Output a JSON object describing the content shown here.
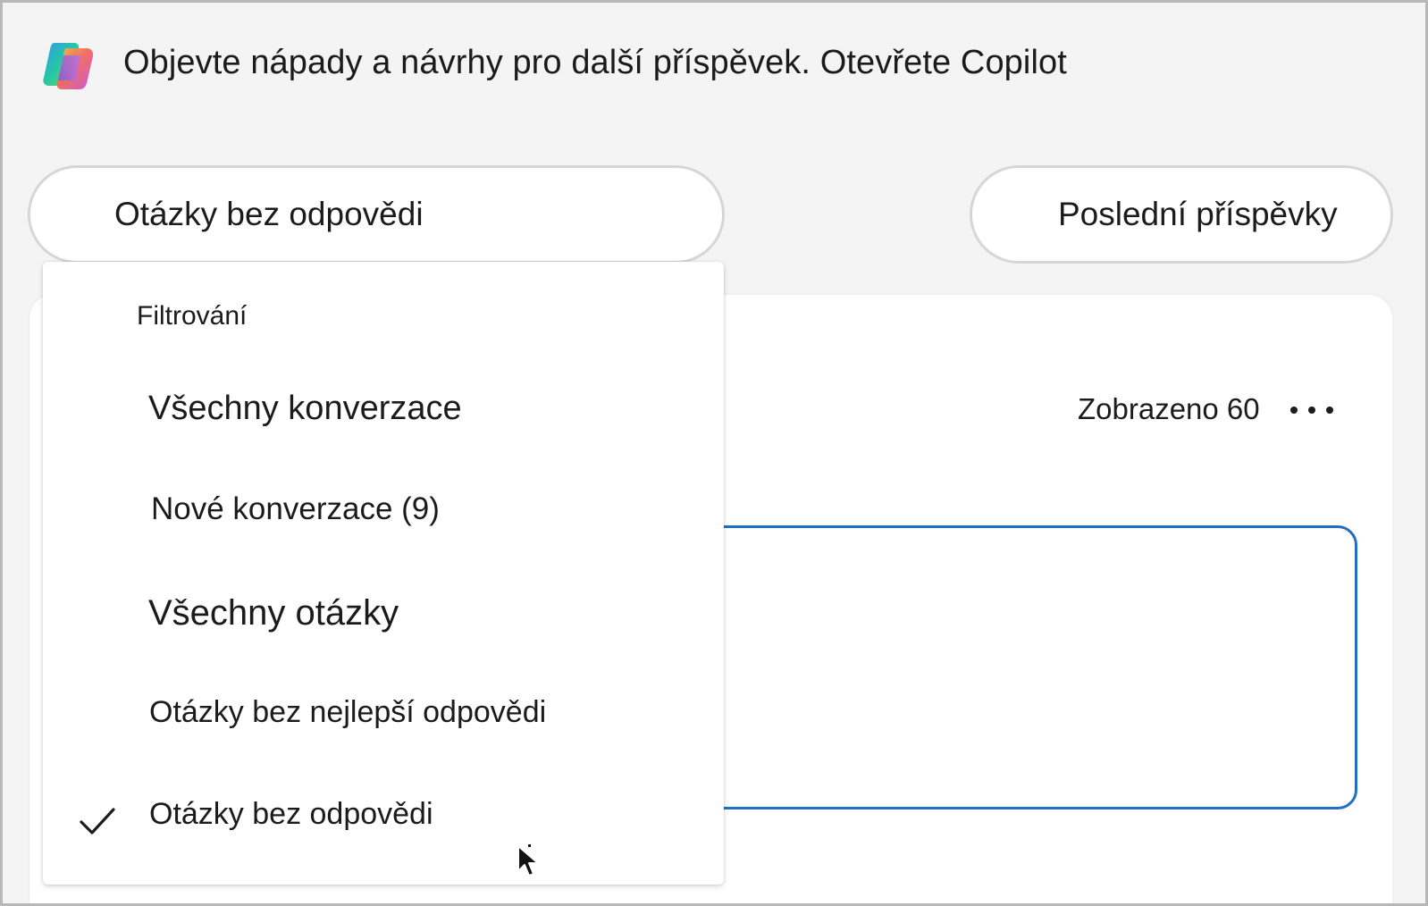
{
  "banner": {
    "text": "Objevte nápady a návrhy pro další příspěvek. Otevřete Copilot",
    "icon": "copilot-logo-icon"
  },
  "filter_pill": {
    "label": "Otázky bez odpovědi"
  },
  "sort_pill": {
    "label": "Poslední příspěvky"
  },
  "feed": {
    "shown_label": "Zobrazeno 60",
    "more_icon": "more-options-icon"
  },
  "dropdown": {
    "header": "Filtrování",
    "items": [
      {
        "label": "Všechny konverzace",
        "selected": false
      },
      {
        "label": "Nové konverzace (9)",
        "selected": false
      },
      {
        "label": "Všechny otázky",
        "selected": false
      },
      {
        "label": "Otázky bez nejlepší odpovědi",
        "selected": false
      },
      {
        "label": "Otázky bez odpovědi",
        "selected": true
      }
    ],
    "check_icon": "checkmark-icon"
  },
  "colors": {
    "accent": "#1f6fc5",
    "background": "#f4f4f4",
    "surface": "#ffffff",
    "text": "#1b1b1b"
  }
}
